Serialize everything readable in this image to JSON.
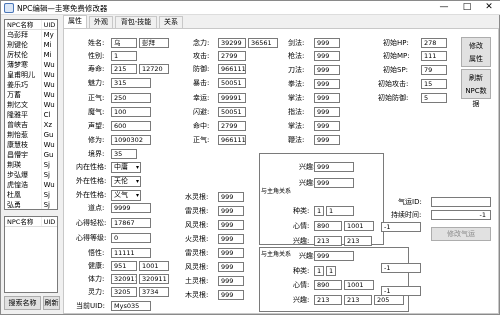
{
  "window": {
    "title": "NPC编辑—圭寒免费修改器",
    "minimize": "—",
    "maximize": "□",
    "close": "✕"
  },
  "npc_list": {
    "col_name": "NPC名称",
    "col_id": "UID",
    "rows": [
      {
        "name": "乌彭拜",
        "id": "My"
      },
      {
        "name": "刑键伦",
        "id": "Mi"
      },
      {
        "name": "厉杖伦",
        "id": "Mi"
      },
      {
        "name": "薄梦寒",
        "id": "Wu"
      },
      {
        "name": "皇甫明儿",
        "id": "Wu"
      },
      {
        "name": "姜乐巧",
        "id": "Wu"
      },
      {
        "name": "万蓄",
        "id": "Wu"
      },
      {
        "name": "荆忆文",
        "id": "Wu"
      },
      {
        "name": "隆雅平",
        "id": "Cl"
      },
      {
        "name": "曾峡吉",
        "id": "Xz"
      },
      {
        "name": "荆怡惹",
        "id": "Gu"
      },
      {
        "name": "康慧枝",
        "id": "Wu"
      },
      {
        "name": "昌懵宇",
        "id": "Gu"
      },
      {
        "name": "荆瑛",
        "id": "Sj"
      },
      {
        "name": "步弘爆",
        "id": "Sj"
      },
      {
        "name": "虎惶浩",
        "id": "Wu"
      },
      {
        "name": "杜凰",
        "id": "Sj"
      },
      {
        "name": "弘勇",
        "id": "Sj"
      }
    ]
  },
  "npc_list2": {
    "col_name": "NPC名称",
    "col_id": "UID"
  },
  "bottom_left": {
    "search_btn": "搜索名称",
    "refresh_btn": "刷新"
  },
  "tabs": [
    {
      "label": "属性"
    },
    {
      "label": "外观"
    },
    {
      "label": "背包-技能"
    },
    {
      "label": "关系"
    }
  ],
  "basic": {
    "name_label": "姓名:",
    "name_first": "乌",
    "name_last": "彭拜",
    "gender_label": "性别:",
    "gender_val": "1",
    "age_label": "寿命:",
    "age_val": "215",
    "age_max": "12720",
    "charm_label": "魅力:",
    "charm_val": "315",
    "righteous_label": "正气:",
    "righteous_val": "250",
    "demonic_label": "魔气:",
    "demonic_val": "100",
    "fame_label": "声望:",
    "fame_val": "600",
    "cultivation_label": "修为:",
    "cultivation_val": "1090302",
    "realm_label": "境界:",
    "realm_val": "35",
    "inner_label": "内在性格:",
    "inner_val": "中庸",
    "outer_label": "外在性格:",
    "outer_val": "天伦",
    "outer2_label": "外在性格:",
    "outer2_val": "义气",
    "dao_label": "道点:",
    "dao_val": "9999",
    "heart_label": "心得轻松:",
    "heart_val": "17867",
    "heart_lv_label": "心得等级:",
    "heart_lv_val": "0",
    "nature_label": "悟性:",
    "nature_val": "11111",
    "health_label": "健康:",
    "health_val": "951",
    "health_max": "1001",
    "stamina_label": "体力:",
    "stamina_val": "320911",
    "stamina_max": "320911",
    "spirit_label": "灵力:",
    "spirit_val": "3205",
    "spirit_max": "3734",
    "uid_label": "当前UID:",
    "uid_val": "Mys035"
  },
  "combat": {
    "power_label": "念力:",
    "power_val": "39299",
    "power_max": "36561",
    "attack_label": "攻击:",
    "attack_val": "2799",
    "defense_label": "防御:",
    "defense_val": "966111",
    "crit_label": "暴击:",
    "crit_val": "50051",
    "luck_label": "幸运:",
    "luck_val": "99991",
    "dodge_label": "闪避:",
    "dodge_val": "50051",
    "hit_label": "命中:",
    "hit_val": "2799",
    "gen_label": "正气:",
    "gen_val": "966111"
  },
  "weapons": {
    "sword_label": "剑法:",
    "sword_val": "999",
    "spear_label": "枪法:",
    "spear_val": "999",
    "blade_label": "刀法:",
    "blade_val": "999",
    "fist_label": "拳法:",
    "fist_val": "999",
    "palm_label": "掌法:",
    "palm_val": "999",
    "finger_label": "指法:",
    "finger_val": "999",
    "hammer_label": "掌法:",
    "hammer_val": "999",
    "whip_label": "鞭法:",
    "whip_val": "999"
  },
  "initial": {
    "init_hp_label": "初始HP:",
    "init_hp_val": "278",
    "init_mp_label": "初始MP:",
    "init_mp_val": "111",
    "init_sp_label": "初始SP:",
    "init_sp_val": "79",
    "init_atk_label": "初始攻击:",
    "init_atk_val": "15",
    "init_def_label": "初始防御:",
    "init_def_val": "5"
  },
  "right_buttons": {
    "modify_label": "修改\n属性",
    "refresh_label": "刷新\nNPC数据"
  },
  "elements": {
    "water_label": "水灵根:",
    "water_val": "999",
    "thunder_label": "雷灵根:",
    "thunder_val": "999",
    "wind_label": "风灵根:",
    "wind_val": "999",
    "fire_label": "火灵根:",
    "fire_val": "999",
    "earth_label": "雷灵根:",
    "earth_val": "999",
    "metal_label": "风灵根:",
    "metal_val": "999",
    "soil_label": "土灵根:",
    "soil_val": "999",
    "wood_label": "木灵根:",
    "wood_val": "999"
  },
  "rel1": {
    "title": "与主角关系",
    "favor_label": "兴趣:",
    "favor_val": "999",
    "type_label": "种类:",
    "type_val": "1",
    "type_val2": "1",
    "mood_label": "心情:",
    "mood_val": "890",
    "mood_max": "1001",
    "interest_label": "兴趣:",
    "interest_a": "213",
    "interest_b": "213",
    "side_val": "-1"
  },
  "rel2": {
    "title": "与主角关系",
    "favor_label": "兴趣:",
    "favor_val": "999",
    "type_label": "种类:",
    "type_val": "1",
    "type_val2": "1",
    "mood_label": "心情:",
    "mood_val": "890",
    "mood_max": "1001",
    "interest_label": "兴趣:",
    "interest_a": "213",
    "interest_b": "213",
    "interest_c": "205",
    "side_val": "-1",
    "side_val2": "-1"
  },
  "qi": {
    "qi_label": "气运ID:",
    "time_label": "持续时间:",
    "time_val": "-1",
    "btn": "修改气运"
  }
}
